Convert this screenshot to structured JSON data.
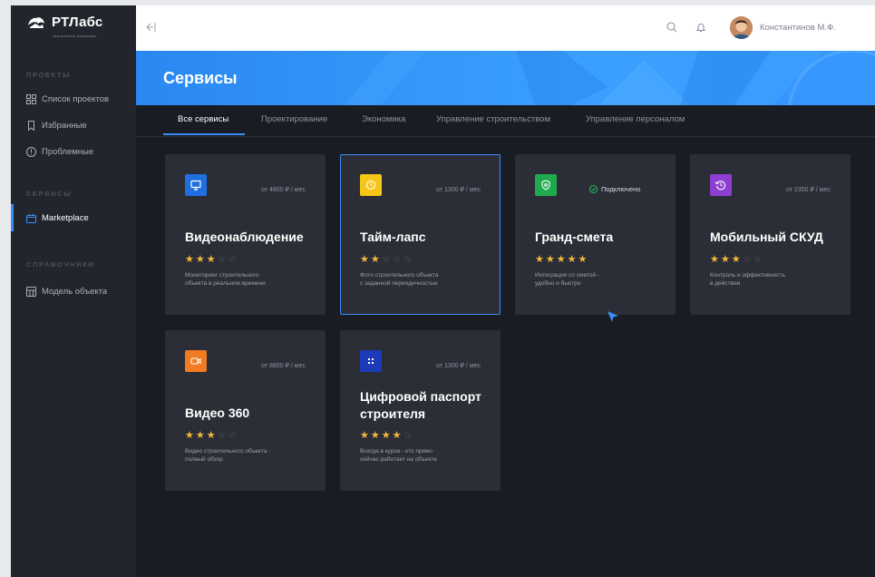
{
  "brand": {
    "name": "РТЛабс",
    "tagline": "ТЕХНОЛОГИИ КОМПАНИИ"
  },
  "colors": {
    "accent": "#3a8bf5",
    "star": "#f7b83a",
    "sidebar_bg": "#22252d",
    "main_bg": "#1a1c23",
    "card_bg": "#2b2e36"
  },
  "sidebar": {
    "sections": [
      {
        "title": "ПРОЕКТЫ",
        "items": [
          {
            "label": "Список проектов",
            "icon": "grid-icon"
          },
          {
            "label": "Избранные",
            "icon": "bookmark-icon"
          },
          {
            "label": "Проблемные",
            "icon": "alert-circle-icon"
          }
        ]
      },
      {
        "title": "СЕРВИСЫ",
        "items": [
          {
            "label": "Marketplace",
            "icon": "box-icon",
            "active": true
          }
        ]
      },
      {
        "title": "СПРАВОЧНИКИ",
        "items": [
          {
            "label": "Модель объекта",
            "icon": "cube-icon"
          }
        ]
      }
    ]
  },
  "topbar": {
    "user_name": "Константинов М.Ф."
  },
  "page": {
    "title": "Сервисы"
  },
  "tabs": [
    {
      "label": "Все сервисы",
      "active": true
    },
    {
      "label": "Проектирование"
    },
    {
      "label": "Экономика"
    },
    {
      "label": "Управление строительством"
    },
    {
      "label": "Управление персоналом"
    }
  ],
  "cards": [
    {
      "title": "Видеонаблюдение",
      "price": "от 4800 ₽ / мес",
      "rating": 3,
      "desc1": "Мониторинг строительного",
      "desc2": "объекта в реальном времени",
      "icon": "monitor-icon",
      "icon_color": "#1f6fe0"
    },
    {
      "title": "Тайм-лапс",
      "price": "от 1300 ₽ / мес",
      "rating": 2,
      "desc1": "Фото строительного объекта",
      "desc2": "с заданной периодичностью",
      "icon": "timer-icon",
      "icon_color": "#f5c518",
      "selected": true
    },
    {
      "title": "Гранд-смета",
      "status": "Подключено",
      "rating": 5,
      "desc1": "Интеграция со сметой -",
      "desc2": "удобно и быстро",
      "icon": "shield-icon",
      "icon_color": "#1faa4f"
    },
    {
      "title": "Мобильный СКУД",
      "price": "от 2350 ₽ / мес",
      "rating": 3,
      "desc1": "Контроль и эффективность",
      "desc2": "в действии",
      "icon": "history-icon",
      "icon_color": "#8e3fd1"
    },
    {
      "title": "Видео 360",
      "price": "от 8800 ₽ / мес",
      "rating": 3,
      "desc1": "Видео строительного объекта -",
      "desc2": "полный обзор",
      "icon": "video-icon",
      "icon_color": "#f07b22"
    },
    {
      "title_line1": "Цифровой паспорт",
      "title_line2": "строителя",
      "price": "от 1300 ₽ / мес",
      "rating": 4,
      "desc1": "Всегда в курсе - кто прямо",
      "desc2": "сейчас работает на объекте",
      "icon": "qr-icon",
      "icon_color": "#1d3bb8"
    }
  ]
}
